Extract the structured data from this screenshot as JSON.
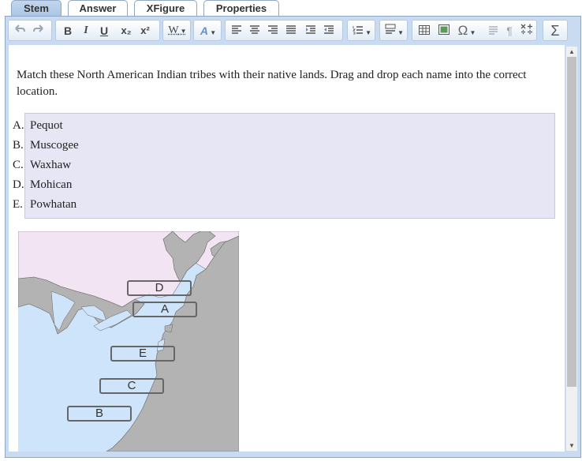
{
  "tabs": [
    {
      "label": "Stem"
    },
    {
      "label": "Answer"
    },
    {
      "label": "XFigure"
    },
    {
      "label": "Properties"
    }
  ],
  "toolbar": {
    "undo_icon": "undo-arrow",
    "redo_icon": "redo-arrow",
    "bold": "B",
    "italic": "I",
    "underline": "U",
    "subscript": "x₂",
    "superscript": "x²",
    "word_style": "W",
    "font_style": "A",
    "omega": "Ω",
    "pilcrow": "¶",
    "sigma": "Σ"
  },
  "content": {
    "prompt": "Match these North American Indian tribes with their native lands. Drag and drop each name into the correct location.",
    "choices": [
      {
        "letter": "A.",
        "name": "Pequot"
      },
      {
        "letter": "B.",
        "name": "Muscogee"
      },
      {
        "letter": "C.",
        "name": "Waxhaw"
      },
      {
        "letter": "D.",
        "name": "Mohican"
      },
      {
        "letter": "E.",
        "name": "Powhatan"
      }
    ],
    "drop_labels": {
      "d": "D",
      "a": "A",
      "e": "E",
      "c": "C",
      "b": "B"
    }
  },
  "colors": {
    "ocean": "#cde4fb",
    "land": "#b3b3b3",
    "canada": "#f3e4f4",
    "choices_bg": "#e6e6f5",
    "tab_active": "#b4cce8"
  }
}
